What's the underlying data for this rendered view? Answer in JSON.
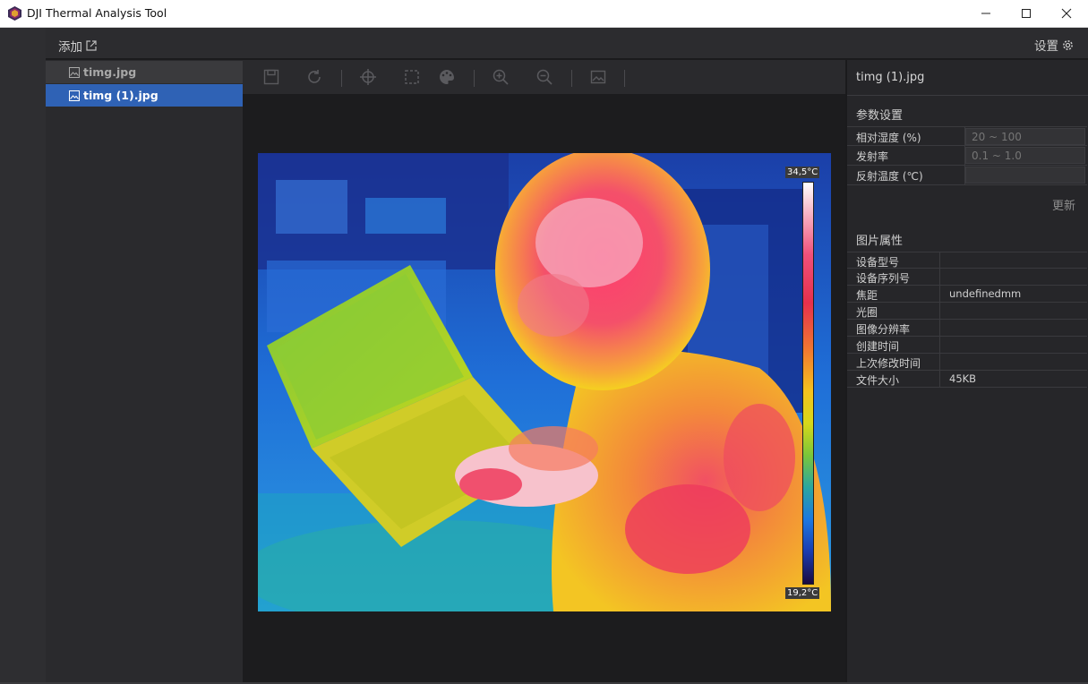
{
  "window": {
    "title": "DJI Thermal Analysis Tool"
  },
  "topbar": {
    "add_label": "添加",
    "settings_label": "设置"
  },
  "files": [
    {
      "name": "timg.jpg",
      "selected": false
    },
    {
      "name": "timg (1).jpg",
      "selected": true
    }
  ],
  "toolbar": {
    "tools": [
      "save-icon",
      "rotate-icon",
      "crosshair-icon",
      "box-select-icon",
      "palette-icon",
      "zoom-in-icon",
      "zoom-out-icon",
      "image-icon"
    ]
  },
  "thermal": {
    "scale_max": "34,5°C",
    "scale_min": "19,2°C"
  },
  "panel": {
    "file_title": "timg (1).jpg",
    "params_title": "参数设置",
    "params": [
      {
        "label": "相对湿度 (%)",
        "placeholder": "20 ~ 100"
      },
      {
        "label": "发射率",
        "placeholder": "0.1 ~ 1.0"
      },
      {
        "label": "反射温度 (℃)",
        "placeholder": ""
      }
    ],
    "update_label": "更新",
    "props_title": "图片属性",
    "props": [
      {
        "label": "设备型号",
        "value": ""
      },
      {
        "label": "设备序列号",
        "value": ""
      },
      {
        "label": "焦距",
        "value": "undefinedmm"
      },
      {
        "label": "光圈",
        "value": ""
      },
      {
        "label": "图像分辨率",
        "value": ""
      },
      {
        "label": "创建时间",
        "value": ""
      },
      {
        "label": "上次修改时间",
        "value": ""
      },
      {
        "label": "文件大小",
        "value": "45KB"
      }
    ]
  },
  "colors": {
    "accent": "#2f62b5",
    "background": "#1c1c1e",
    "panel": "#262629"
  }
}
